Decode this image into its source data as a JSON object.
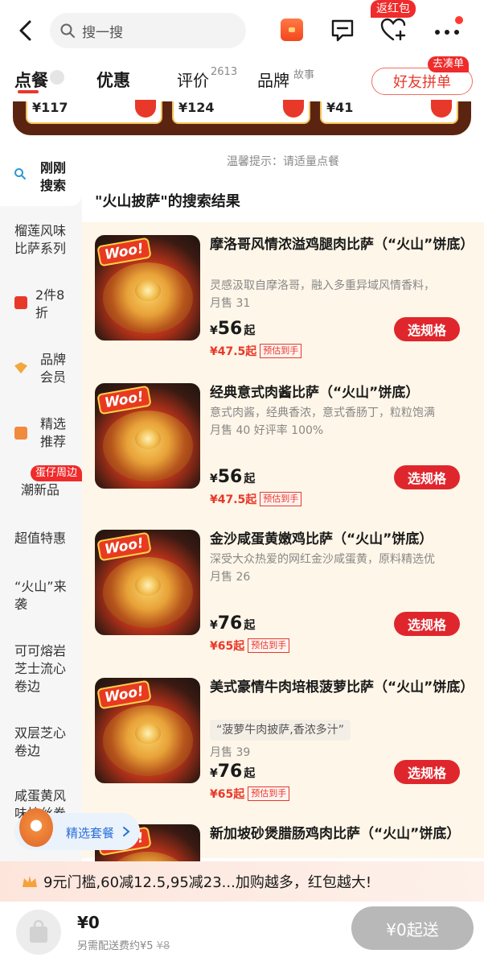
{
  "header": {
    "search_placeholder": "搜一搜",
    "fav_badge": "返红包"
  },
  "tabs": {
    "order": "点餐",
    "deals": "优惠",
    "reviews": "评价",
    "reviews_count": "2613",
    "brand": "品牌",
    "brand_sup": "故事",
    "friend_button": "好友拼单",
    "friend_badge": "去凑单"
  },
  "banner": {
    "prices": [
      "¥117",
      "¥124",
      "¥41"
    ]
  },
  "sidebar": {
    "items": [
      {
        "label": "刚刚\n搜索"
      },
      {
        "label": "榴莲风味\n比萨系列"
      },
      {
        "label": "2件8\n折"
      },
      {
        "label": "品牌\n会员"
      },
      {
        "label": "精选\n推荐"
      },
      {
        "label": "潮新品"
      },
      {
        "label": "超值特惠"
      },
      {
        "label": "“火山”来\n袭"
      },
      {
        "label": "可可熔岩\n芝士流心\n卷边"
      },
      {
        "label": "双层芝心\n卷边"
      },
      {
        "label": "咸蛋黄风\n味拉丝卷"
      }
    ],
    "new_badge": "蛋仔周边"
  },
  "main": {
    "tip": "温馨提示：请适量点餐",
    "result_title": "\"火山披萨\"的搜索结果",
    "products": [
      {
        "name": "摩洛哥风情浓溢鸡腿肉比萨（“火山”饼底）",
        "desc": "灵感汲取自摩洛哥，融入多重异域风情香料，",
        "tag": "",
        "sales": "月售 31",
        "price": "56",
        "est_price": "¥47.5起",
        "button": "选规格"
      },
      {
        "name": "经典意式肉酱比萨（“火山”饼底）",
        "desc": "意式肉酱，经典香浓，意式香肠丁，粒粒饱满",
        "tag": "",
        "sales": "月售 40  好评率 100%",
        "price": "56",
        "est_price": "¥47.5起",
        "button": "选规格"
      },
      {
        "name": "金沙咸蛋黄嫩鸡比萨（“火山”饼底）",
        "desc": "深受大众热爱的网红金沙咸蛋黄，原料精选优",
        "tag": "",
        "sales": "月售 26",
        "price": "76",
        "est_price": "¥65起",
        "button": "选规格"
      },
      {
        "name": "美式豪情牛肉培根菠萝比萨（“火山”饼底）",
        "desc": "",
        "tag": "“菠萝牛肉披萨,香浓多汁”",
        "sales": "月售 39",
        "price": "76",
        "est_price": "¥65起",
        "button": "选规格"
      },
      {
        "name": "新加坡砂煲腊肠鸡肉比萨（“火山”饼底）",
        "desc": "",
        "tag": "",
        "sales": "",
        "price": "",
        "est_price": "",
        "button": ""
      }
    ],
    "currency": "¥",
    "price_suffix": "起",
    "est_label": "预估到手",
    "img_badge": "Woo!"
  },
  "combo": {
    "label": "精选套餐"
  },
  "promo": {
    "text": "9元门槛,60减12.5,95减23...加购越多，红包越大!"
  },
  "cart": {
    "total": "¥0",
    "delivery_note": "另需配送费约¥5",
    "delivery_original": "¥8",
    "checkout": "¥0起送"
  },
  "colors": {
    "accent": "#e0262d",
    "list_bg": "#fef6e8",
    "sidebar_bg": "#f6f6f6",
    "checkout_disabled": "#b8b8b8"
  }
}
